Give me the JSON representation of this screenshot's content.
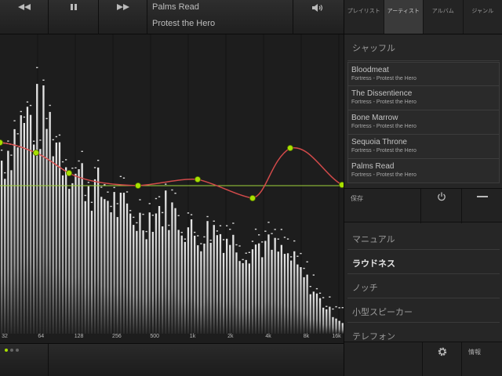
{
  "top_bar": {
    "rewind_icon": "rewind-icon",
    "pause_icon": "pause-icon",
    "fastforward_icon": "fast-forward-icon",
    "now_playing_title": "Palms Read",
    "now_playing_artist": "Protest the Hero",
    "volume_icon": "volume-icon"
  },
  "tabs": [
    {
      "label": "プレイリスト",
      "active": false
    },
    {
      "label": "アーティスト",
      "active": true
    },
    {
      "label": "アルバム",
      "active": false
    },
    {
      "label": "ジャンル",
      "active": false
    }
  ],
  "shuffle_label": "シャッフル",
  "tracks": [
    {
      "name": "Bloodmeat",
      "sub": "Fortress - Protest the Hero"
    },
    {
      "name": "The Dissentience",
      "sub": "Fortress - Protest the Hero"
    },
    {
      "name": "Bone Marrow",
      "sub": "Fortress - Protest the Hero"
    },
    {
      "name": "Sequoia Throne",
      "sub": "Fortress - Protest the Hero"
    },
    {
      "name": "Palms Read",
      "sub": "Fortress - Protest the Hero"
    }
  ],
  "controls": {
    "save_label": "保存",
    "power_icon": "power-icon",
    "minus_icon": "minus-icon"
  },
  "presets": [
    {
      "label": "マニュアル",
      "active": false
    },
    {
      "label": "ラウドネス",
      "active": true
    },
    {
      "label": "ノッチ",
      "active": false
    },
    {
      "label": "小型スピーカー",
      "active": false
    },
    {
      "label": "テレフォン",
      "active": false
    }
  ],
  "bottom": {
    "gear_icon": "gear-icon",
    "info_label": "情報"
  },
  "colors": {
    "eq_curve": "#d24a4a",
    "eq_node": "#a8e000",
    "flat_line": "#9fd23a",
    "bars": "#e8e8e8",
    "page_dot_active": "#a8e000",
    "page_dot_inactive": "#666666"
  },
  "page_dots": {
    "count": 3,
    "active": 0
  },
  "spectrum": {
    "freq_labels": [
      "32",
      "64",
      "128",
      "256",
      "500",
      "1k",
      "2k",
      "4k",
      "8k",
      "16k"
    ]
  }
}
